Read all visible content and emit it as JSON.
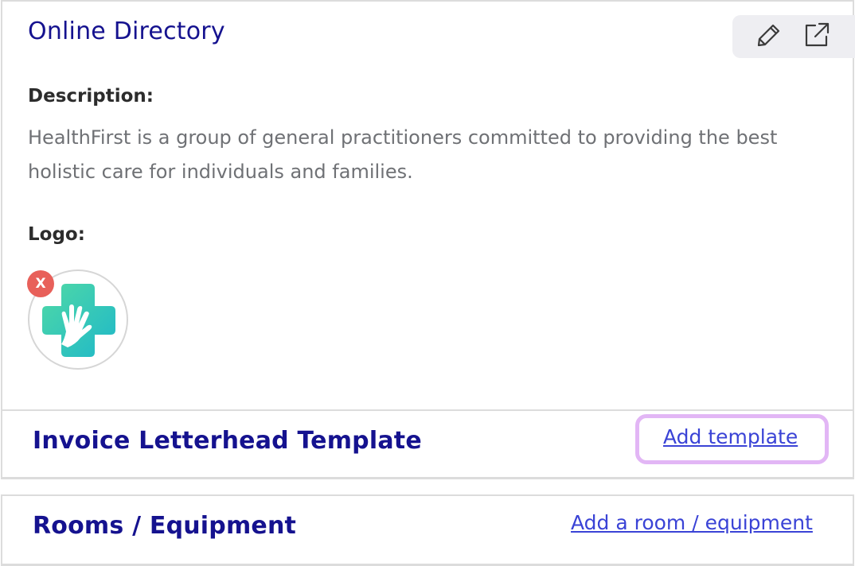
{
  "online_directory": {
    "title": "Online Directory",
    "toolbar": {
      "edit_icon": "pencil-icon",
      "open_icon": "external-link-icon"
    },
    "description_label": "Description:",
    "description_text": "HealthFirst is a group of general practitioners committed to providing the best holistic care for individuals and families.",
    "logo_label": "Logo:",
    "remove_logo_label": "X"
  },
  "invoice_section": {
    "title": "Invoice Letterhead Template",
    "link_label": "Add template"
  },
  "rooms_section": {
    "title": "Rooms / Equipment",
    "link_label": "Add a room / equipment"
  },
  "colors": {
    "heading": "#15128f",
    "link": "#3a43d6",
    "highlight": "#e2b6f5",
    "remove_badge": "#e8605a",
    "logo_gradient_start": "#4fd9a6",
    "logo_gradient_end": "#1fb8c9"
  }
}
